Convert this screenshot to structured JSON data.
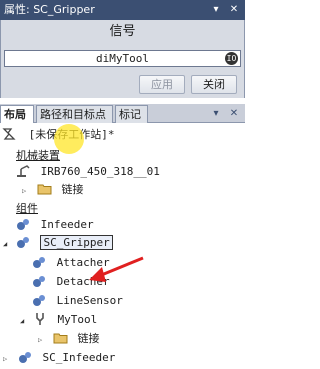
{
  "properties": {
    "title": "属性: SC_Gripper",
    "header": "信号",
    "signal_value": "diMyTool",
    "io_icon": "IO",
    "apply_label": "应用",
    "close_label": "关闭"
  },
  "window_controls": {
    "pin": "▾",
    "dock": "ᐅ",
    "close": "✕"
  },
  "layout": {
    "tabs": [
      {
        "label": "布局"
      },
      {
        "label": "路径和目标点"
      },
      {
        "label": "标记"
      }
    ],
    "station": "[未保存工作站]*",
    "mechanisms_heading": "机械装置",
    "robot": "IRB760_450_318__01",
    "robot_link": "链接",
    "components_heading": "组件",
    "infeeder": "Infeeder",
    "selected_component": "SC_Gripper",
    "children": [
      "Attacher",
      "Detacher",
      "LineSensor"
    ],
    "tool": "MyTool",
    "tool_link": "链接",
    "last_component": "SC_Infeeder"
  },
  "colors": {
    "title_bar": "#3b4f72",
    "panel_bg": "#d7dbe3",
    "arrow": "#e02020",
    "cursor_highlight": "#ffe628"
  }
}
